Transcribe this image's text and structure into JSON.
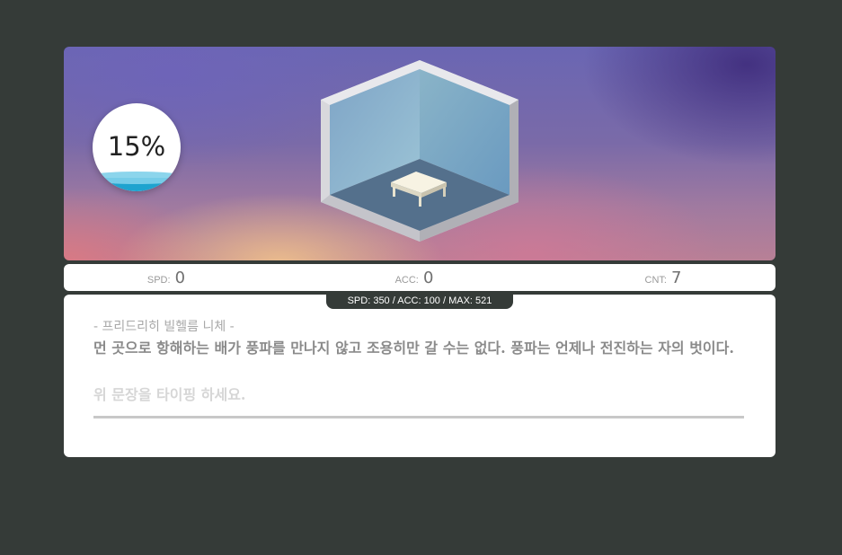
{
  "progress": {
    "percent_text": "15%",
    "fill_fraction": 0.15
  },
  "stats": {
    "spd": {
      "label": "SPD:",
      "value": "0"
    },
    "acc": {
      "label": "ACC:",
      "value": "0"
    },
    "cnt": {
      "label": "CNT:",
      "value": "7"
    }
  },
  "badge": {
    "text": "SPD: 350 / ACC: 100 / MAX: 521"
  },
  "quote": {
    "author": "- 프리드리히 빌헬름 니체 -",
    "text": "먼 곳으로 항해하는 배가 풍파를 만나지 않고 조용히만 갈 수는 없다. 풍파는 언제나 전진하는 자의 벗이다.",
    "hint": "위 문장을 타이핑 하세요."
  },
  "input": {
    "value": ""
  },
  "colors": {
    "background": "#353b38",
    "wave": "#1ea3cf",
    "panel": "#ffffff"
  }
}
